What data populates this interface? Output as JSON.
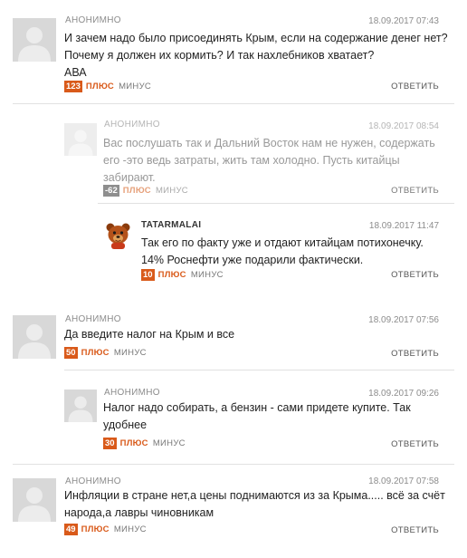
{
  "comments": [
    {
      "author": "АНОНИМНО",
      "date": "18.09.2017 07:43",
      "text": "И зачем надо было присоединять Крым, если на содержание денег нет?\nПочему я должен их кормить? И так нахлебников хватает?\nАВА",
      "score": "123",
      "plus": "ПЛЮС",
      "minus": "МИНУС",
      "reply": "ОТВЕТИТЬ"
    },
    {
      "author": "АНОНИМНО",
      "date": "18.09.2017 08:54",
      "text": "Вас послушать так и Дальний Восток нам не нужен, содержать\nего -это ведь затраты, жить там холодно. Пусть китайцы\nзабирают.",
      "score": "-62",
      "plus": "ПЛЮС",
      "minus": "МИНУС",
      "reply": "ОТВЕТИТЬ"
    },
    {
      "author": "TATARMALAI",
      "date": "18.09.2017 11:47",
      "text": "Так его по факту уже и отдают китайцам потихонечку.\n14% Роснефти уже подарили фактически.",
      "score": "10",
      "plus": "ПЛЮС",
      "minus": "МИНУС",
      "reply": "ОТВЕТИТЬ"
    },
    {
      "author": "АНОНИМНО",
      "date": "18.09.2017 07:56",
      "text": "Да введите налог на Крым и все",
      "score": "50",
      "plus": "ПЛЮС",
      "minus": "МИНУС",
      "reply": "ОТВЕТИТЬ"
    },
    {
      "author": "АНОНИМНО",
      "date": "18.09.2017 09:26",
      "text": "Налог надо собирать, а бензин - сами придете купите. Так\nудобнее",
      "score": "30",
      "plus": "ПЛЮС",
      "minus": "МИНУС",
      "reply": "ОТВЕТИТЬ"
    },
    {
      "author": "АНОНИМНО",
      "date": "18.09.2017 07:58",
      "text": "Инфляции в стране нет,а цены поднимаются из за Крыма..... всё за счёт\nнарода,а лавры чиновникам",
      "score": "49",
      "plus": "ПЛЮС",
      "minus": "МИНУС",
      "reply": "ОТВЕТИТЬ"
    }
  ],
  "colors": {
    "accent": "#d95a1a",
    "muted": "#8c8c8c",
    "negative_badge": "#777777"
  },
  "icons": {
    "default_avatar": "user-silhouette-icon",
    "custom_avatar": "bear-avatar-icon"
  }
}
